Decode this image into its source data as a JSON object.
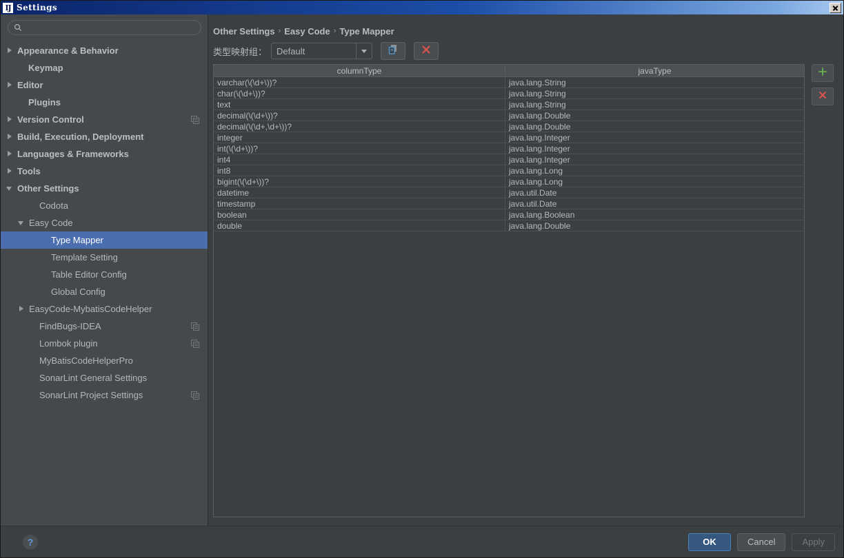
{
  "window": {
    "title": "Settings",
    "app_icon": "IJ",
    "close_label": "✕"
  },
  "search": {
    "value": "",
    "placeholder": "",
    "icon": "search-icon"
  },
  "sidebar": {
    "items": [
      {
        "label": "Appearance & Behavior",
        "arrow": "right",
        "bold": true,
        "indent": 8,
        "scope_icon": false,
        "selected": false
      },
      {
        "label": "Keymap",
        "arrow": "none",
        "bold": true,
        "indent": 24,
        "scope_icon": false,
        "selected": false
      },
      {
        "label": "Editor",
        "arrow": "right",
        "bold": true,
        "indent": 8,
        "scope_icon": false,
        "selected": false
      },
      {
        "label": "Plugins",
        "arrow": "none",
        "bold": true,
        "indent": 24,
        "scope_icon": false,
        "selected": false
      },
      {
        "label": "Version Control",
        "arrow": "right",
        "bold": true,
        "indent": 8,
        "scope_icon": true,
        "selected": false
      },
      {
        "label": "Build, Execution, Deployment",
        "arrow": "right",
        "bold": true,
        "indent": 8,
        "scope_icon": false,
        "selected": false
      },
      {
        "label": "Languages & Frameworks",
        "arrow": "right",
        "bold": true,
        "indent": 8,
        "scope_icon": false,
        "selected": false
      },
      {
        "label": "Tools",
        "arrow": "right",
        "bold": true,
        "indent": 8,
        "scope_icon": false,
        "selected": false
      },
      {
        "label": "Other Settings",
        "arrow": "down",
        "bold": true,
        "indent": 8,
        "scope_icon": false,
        "selected": false
      },
      {
        "label": "Codota",
        "arrow": "none",
        "bold": false,
        "indent": 40,
        "scope_icon": false,
        "selected": false
      },
      {
        "label": "Easy Code",
        "arrow": "down",
        "bold": false,
        "indent": 25,
        "scope_icon": false,
        "selected": false
      },
      {
        "label": "Type Mapper",
        "arrow": "none",
        "bold": false,
        "indent": 57,
        "scope_icon": false,
        "selected": true
      },
      {
        "label": "Template Setting",
        "arrow": "none",
        "bold": false,
        "indent": 57,
        "scope_icon": false,
        "selected": false
      },
      {
        "label": "Table Editor Config",
        "arrow": "none",
        "bold": false,
        "indent": 57,
        "scope_icon": false,
        "selected": false
      },
      {
        "label": "Global Config",
        "arrow": "none",
        "bold": false,
        "indent": 57,
        "scope_icon": false,
        "selected": false
      },
      {
        "label": "EasyCode-MybatisCodeHelper",
        "arrow": "right",
        "bold": false,
        "indent": 25,
        "scope_icon": false,
        "selected": false
      },
      {
        "label": "FindBugs-IDEA",
        "arrow": "none",
        "bold": false,
        "indent": 40,
        "scope_icon": true,
        "selected": false
      },
      {
        "label": "Lombok plugin",
        "arrow": "none",
        "bold": false,
        "indent": 40,
        "scope_icon": true,
        "selected": false
      },
      {
        "label": "MyBatisCodeHelperPro",
        "arrow": "none",
        "bold": false,
        "indent": 40,
        "scope_icon": false,
        "selected": false
      },
      {
        "label": "SonarLint General Settings",
        "arrow": "none",
        "bold": false,
        "indent": 40,
        "scope_icon": false,
        "selected": false
      },
      {
        "label": "SonarLint Project Settings",
        "arrow": "none",
        "bold": false,
        "indent": 40,
        "scope_icon": true,
        "selected": false
      }
    ]
  },
  "breadcrumb": {
    "parts": [
      "Other Settings",
      "Easy Code",
      "Type Mapper"
    ],
    "separator": "›"
  },
  "toolbar": {
    "group_label": "类型映射组：",
    "group_value": "Default",
    "copy_button_name": "copy-type-mapper-group",
    "delete_button_name": "delete-type-mapper-group"
  },
  "table": {
    "columns": [
      "columnType",
      "javaType"
    ],
    "rows": [
      [
        "varchar(\\(\\d+\\))?",
        "java.lang.String"
      ],
      [
        "char(\\(\\d+\\))?",
        "java.lang.String"
      ],
      [
        "text",
        "java.lang.String"
      ],
      [
        "decimal(\\(\\d+\\))?",
        "java.lang.Double"
      ],
      [
        "decimal(\\(\\d+,\\d+\\))?",
        "java.lang.Double"
      ],
      [
        "integer",
        "java.lang.Integer"
      ],
      [
        "int(\\(\\d+\\))?",
        "java.lang.Integer"
      ],
      [
        "int4",
        "java.lang.Integer"
      ],
      [
        "int8",
        "java.lang.Long"
      ],
      [
        "bigint(\\(\\d+\\))?",
        "java.lang.Long"
      ],
      [
        "datetime",
        "java.util.Date"
      ],
      [
        "timestamp",
        "java.util.Date"
      ],
      [
        "boolean",
        "java.lang.Boolean"
      ],
      [
        "double",
        "java.lang.Double"
      ]
    ]
  },
  "side_actions": {
    "add_label": "+",
    "remove_label": "✕"
  },
  "footer": {
    "help_label": "?",
    "ok_label": "OK",
    "cancel_label": "Cancel",
    "apply_label": "Apply"
  },
  "colors": {
    "selection": "#4b6eaf",
    "primary_button": "#365880",
    "add_icon": "#6ab04c",
    "remove_icon": "#d9534f",
    "help_icon": "#5f9ad8",
    "panel_bg": "#3c3f41",
    "sidebar_bg": "#45484d"
  }
}
